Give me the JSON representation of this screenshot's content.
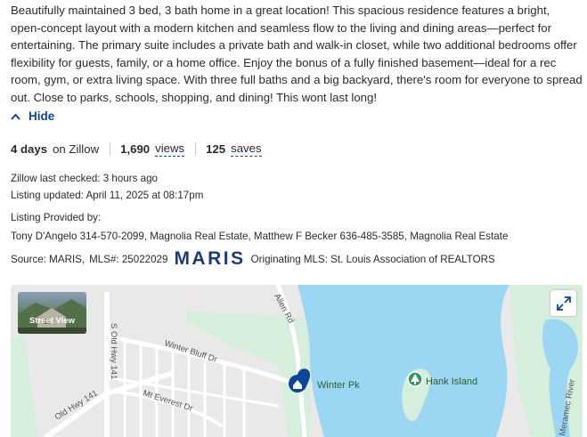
{
  "description": "Beautifully maintained 3 bed, 3 bath home in a great location! This spacious residence features a bright, open-concept layout with a modern kitchen and seamless flow to the living and dining areas—perfect for entertaining. The primary suite includes a private bath and walk-in closet, while two additional bedrooms offer flexibility for guests, family, or a home office. Enjoy the bonus of a fully finished basement—ideal for a rec room, gym, or extra living space. With three full baths and a big backyard, there's room for everyone to spread out. Close to parks, schools, shopping, and dining! This wont last long!",
  "hide_label": "Hide",
  "stats": {
    "days_value": "4 days",
    "days_label": "on Zillow",
    "views_value": "1,690",
    "views_label": "views",
    "saves_value": "125",
    "saves_label": "saves"
  },
  "checked": "Zillow last checked: 3 hours ago",
  "updated": "Listing updated: April 11, 2025 at 08:17pm",
  "provided_by_label": "Listing Provided by:",
  "agents": "Tony D'Angelo 314-570-2099, Magnolia Real Estate, Matthew F Becker 636-485-3585, Magnolia Real Estate",
  "source": {
    "source_text": "Source: MARIS,",
    "mls_text": "MLS#: 25022029",
    "logo_text": "MARIS",
    "originating": "Originating MLS: St. Louis Association of REALTORS"
  },
  "map": {
    "street_view_label": "Street View",
    "roads": {
      "allen_rd": "Allen Rd",
      "s_old_hwy": "S Old Hwy 141",
      "winter_bluff": "Winter Bluff Dr",
      "old_hwy": "Old Hwy 141",
      "mt_everest": "Mt Everest Dr",
      "river": "Meramec River"
    },
    "places": {
      "winter_pk": "Winter Pk",
      "hank_island": "Hank Island"
    },
    "colors": {
      "water": "#9bd7f2",
      "park": "#d6efdc",
      "road": "#ffffff",
      "land": "#e9e9e9",
      "pin": "#0d4599",
      "park_pin": "#2e9a55"
    }
  }
}
